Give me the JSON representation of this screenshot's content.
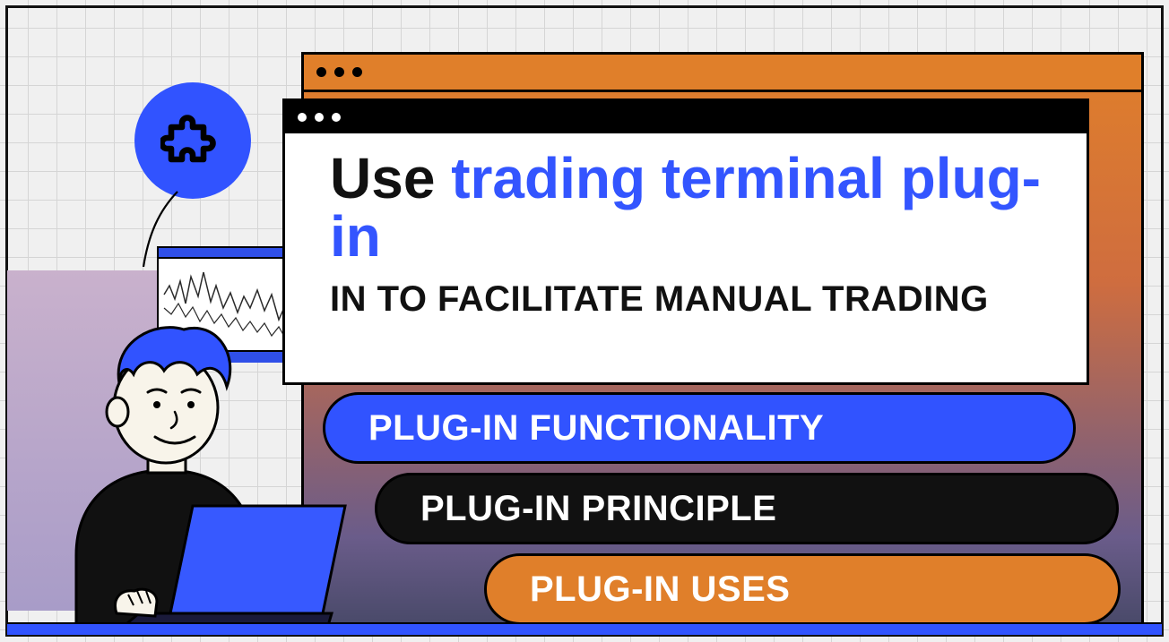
{
  "headline": {
    "prefix": "Use ",
    "highlight": "trading terminal plug-in",
    "subtitle": "IN TO FACILITATE MANUAL TRADING"
  },
  "pills": {
    "functionality": "PLUG-IN FUNCTIONALITY",
    "principle": "PLUG-IN PRINCIPLE",
    "uses": "PLUG-IN USES"
  },
  "icons": {
    "puzzle": "puzzle-piece"
  },
  "colors": {
    "blue": "#3153ff",
    "orange": "#e07f2a",
    "black": "#111111"
  }
}
